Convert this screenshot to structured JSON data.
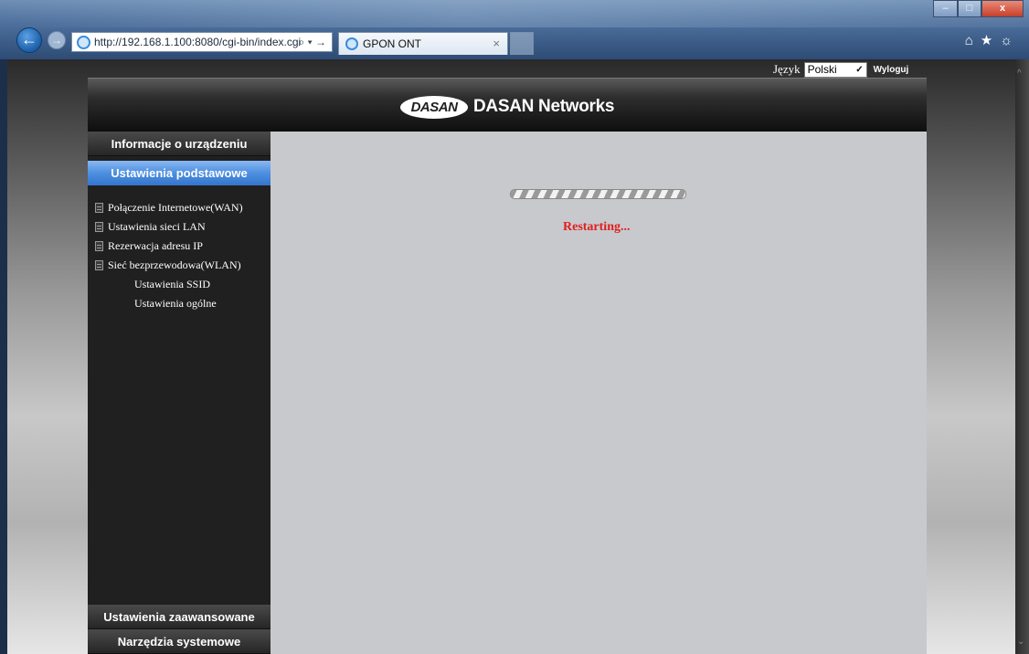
{
  "browser": {
    "url": "http://192.168.1.100:8080/cgi-bin/index.cgi",
    "search_tools": "⌕ ▾ →",
    "tab_title": "GPON ONT",
    "tab_close": "×",
    "window_min": "–",
    "window_max": "□",
    "window_close": "x",
    "icons": [
      "back-arrow-icon",
      "forward-arrow-icon",
      "ie-logo-icon",
      "home-icon",
      "favorites-star-icon",
      "settings-gear-icon"
    ]
  },
  "language_bar": {
    "label": "Język",
    "selected": "Polski",
    "logout": "Wyloguj"
  },
  "header": {
    "logo_mark": "DASAN",
    "logo_text": "DASAN Networks"
  },
  "sidebar": {
    "device_info": "Informacje o urządzeniu",
    "basic_settings": "Ustawienia podstawowe",
    "items": [
      {
        "label": "Połączenie Internetowe(WAN)"
      },
      {
        "label": "Ustawienia sieci LAN"
      },
      {
        "label": "Rezerwacja adresu IP"
      },
      {
        "label": "Sieć bezprzewodowa(WLAN)"
      }
    ],
    "subitems": [
      {
        "label": "Ustawienia SSID"
      },
      {
        "label": "Ustawienia ogólne"
      }
    ],
    "advanced_settings": "Ustawienia zaawansowane",
    "system_tools": "Narzędzia systemowe"
  },
  "content": {
    "status": "Restarting...",
    "status_color": "#e01e1e"
  },
  "colors": {
    "active_menu": "#4d8fe0",
    "content_bg": "#c8c9cd",
    "sidebar_bg": "#202020"
  }
}
